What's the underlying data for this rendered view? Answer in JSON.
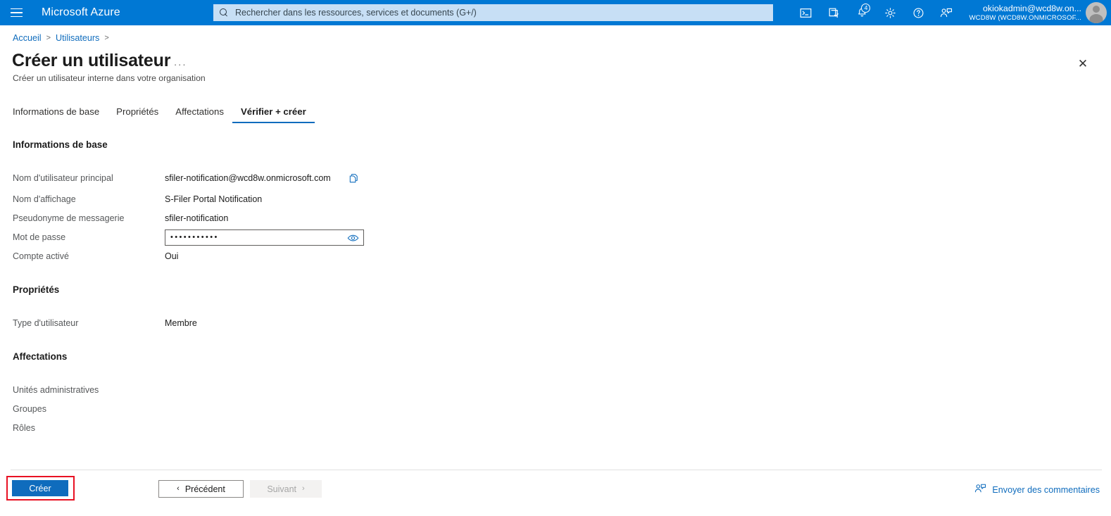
{
  "topbar": {
    "menu_icon": "hamburger-icon",
    "brand": "Microsoft Azure",
    "search": {
      "icon": "search-icon",
      "placeholder": "Rechercher dans les ressources, services et documents (G+/)",
      "value": ""
    },
    "icons": [
      {
        "name": "cloud-shell-icon"
      },
      {
        "name": "directories-subscriptions-icon"
      },
      {
        "name": "notifications-bell-icon",
        "badge": "4"
      },
      {
        "name": "settings-gear-icon"
      },
      {
        "name": "help-question-icon"
      },
      {
        "name": "feedback-person-icon"
      }
    ],
    "account": {
      "email": "okiokadmin@wcd8w.on...",
      "tenant": "WCD8W (WCD8W.ONMICROSOF...",
      "avatar": "user-avatar"
    }
  },
  "breadcrumb": {
    "items": [
      "Accueil",
      "Utilisateurs"
    ],
    "separator": ">"
  },
  "page": {
    "title": "Créer un utilisateur",
    "more_menu": "···",
    "subtitle": "Créer un utilisateur interne dans votre organisation",
    "close_label": "✕"
  },
  "tabs": [
    {
      "label": "Informations de base",
      "active": false
    },
    {
      "label": "Propriétés",
      "active": false
    },
    {
      "label": "Affectations",
      "active": false
    },
    {
      "label": "Vérifier + créer",
      "active": true
    }
  ],
  "sections": {
    "basics": {
      "heading": "Informations de base",
      "rows": [
        {
          "label": "Nom d'utilisateur principal",
          "value": "sfiler-notification@wcd8w.onmicrosoft.com",
          "copy": "copy-icon"
        },
        {
          "label": "Nom d'affichage",
          "value": "S-Filer Portal Notification"
        },
        {
          "label": "Pseudonyme de messagerie",
          "value": "sfiler-notification"
        },
        {
          "label": "Mot de passe",
          "value": "•••••••••••",
          "masked": true,
          "reveal_icon": "eye-icon"
        },
        {
          "label": "Compte activé",
          "value": "Oui"
        }
      ]
    },
    "properties": {
      "heading": "Propriétés",
      "rows": [
        {
          "label": "Type d'utilisateur",
          "value": "Membre"
        }
      ]
    },
    "assignments": {
      "heading": "Affectations",
      "rows": [
        {
          "label": "Unités administratives",
          "value": ""
        },
        {
          "label": "Groupes",
          "value": ""
        },
        {
          "label": "Rôles",
          "value": ""
        }
      ]
    }
  },
  "footer": {
    "create_label": "Créer",
    "previous_label": "Précédent",
    "previous_chevron": "‹",
    "next_label": "Suivant",
    "next_chevron": "›",
    "next_disabled": true,
    "feedback_label": "Envoyer des commentaires",
    "feedback_icon": "feedback-person-icon"
  },
  "colors": {
    "azure_blue": "#0078d4",
    "link_blue": "#0f6cbd",
    "highlight_red": "#e81123",
    "search_bg": "#c7dff5"
  }
}
